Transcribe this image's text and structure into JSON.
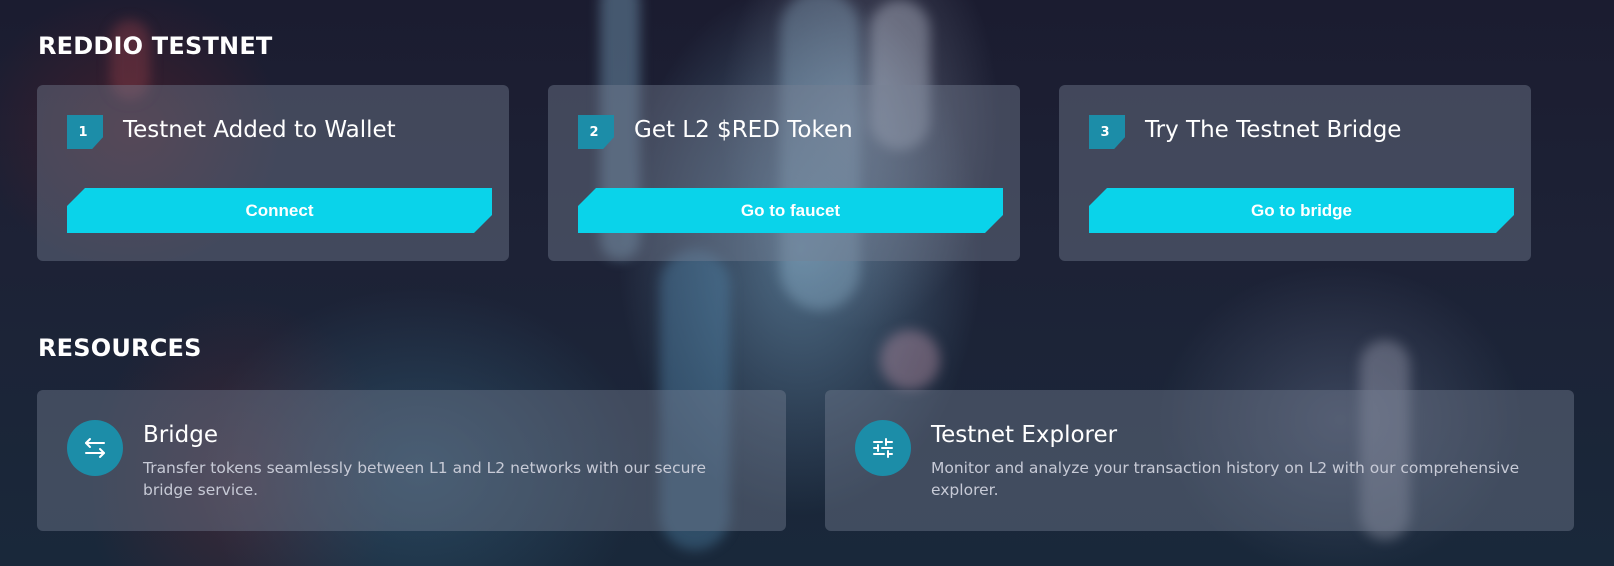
{
  "testnet": {
    "heading": "REDDIO TESTNET",
    "steps": [
      {
        "number": "1",
        "title": "Testnet Added to Wallet",
        "button_label": "Connect"
      },
      {
        "number": "2",
        "title": "Get L2 $RED Token",
        "button_label": "Go to faucet"
      },
      {
        "number": "3",
        "title": "Try The Testnet Bridge",
        "button_label": "Go to bridge"
      }
    ]
  },
  "resources": {
    "heading": "RESOURCES",
    "items": [
      {
        "icon": "swap-arrows-icon",
        "title": "Bridge",
        "description": "Transfer tokens seamlessly between L1 and L2 networks with our secure bridge service."
      },
      {
        "icon": "sliders-icon",
        "title": "Testnet Explorer",
        "description": "Monitor and analyze your transaction history on L2 with our comprehensive explorer."
      }
    ]
  },
  "colors": {
    "accent": "#0ad3ea",
    "badge": "#1c8da8",
    "card": "rgba(120,128,148,0.42)"
  }
}
